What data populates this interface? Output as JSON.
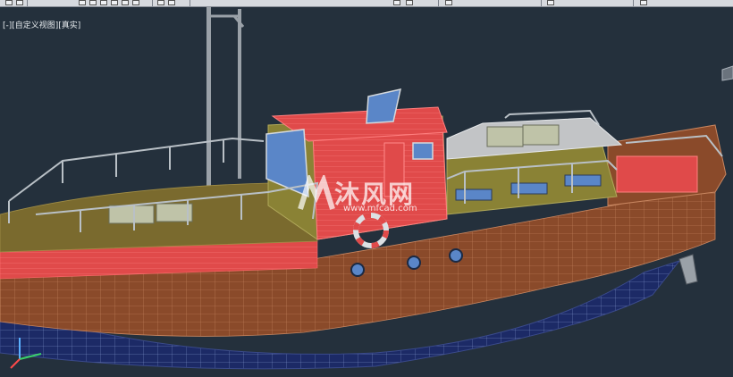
{
  "viewport": {
    "view_label": "[-][自定义视图][真实]",
    "background": "#24303c"
  },
  "watermark": {
    "text": "沐风网",
    "url": "www.mfcad.com"
  },
  "colors": {
    "hull_wood": "#8a4a2a",
    "underwater": "#1c2a66",
    "bulwark_red": "#e04a4a",
    "deck_olive": "#7a6a2e",
    "cabin_olive": "#8a8235",
    "railing": "#b9c0c6",
    "window_blue": "#5a86c8"
  },
  "icons": [
    "ucs-axis-icon",
    "view-cube-icon"
  ]
}
